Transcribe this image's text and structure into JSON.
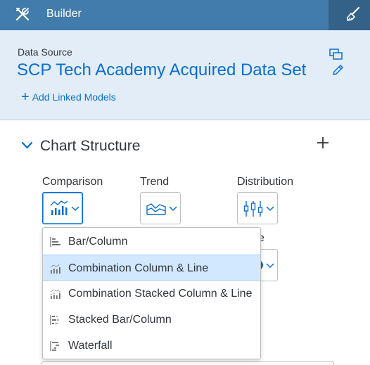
{
  "header": {
    "title": "Builder",
    "tools_icon": "tools-icon",
    "designer_icon": "paint-brush-icon",
    "bg_color": "#427cac",
    "active_tab_color": "#346187"
  },
  "data_source": {
    "label": "Data Source",
    "name": "SCP Tech Academy Acquired Data Set",
    "add_linked_models": "Add Linked Models",
    "copy_icon": "copy-icon",
    "edit_icon": "pencil-icon"
  },
  "chart_structure": {
    "title": "Chart Structure",
    "add_icon": "plus-icon",
    "categories": [
      {
        "label": "Comparison",
        "icon": "comparison-chart-icon",
        "active": true
      },
      {
        "label": "Trend",
        "icon": "trend-chart-icon",
        "active": false
      },
      {
        "label": "Distribution",
        "icon": "distribution-chart-icon",
        "active": false
      }
    ],
    "partial_label": "e"
  },
  "dropdown": {
    "items": [
      {
        "label": "Bar/Column",
        "icon": "bar-column-icon",
        "selected": false
      },
      {
        "label": "Combination Column & Line",
        "icon": "combination-column-line-icon",
        "selected": true
      },
      {
        "label": "Combination Stacked Column & Line",
        "icon": "combination-stacked-column-line-icon",
        "selected": false
      },
      {
        "label": "Stacked Bar/Column",
        "icon": "stacked-bar-column-icon",
        "selected": false
      },
      {
        "label": "Waterfall",
        "icon": "waterfall-icon",
        "selected": false
      }
    ]
  },
  "colors": {
    "accent": "#0a6ed1",
    "section_bg": "#e3edf7",
    "selected_bg": "#d1e8ff"
  }
}
